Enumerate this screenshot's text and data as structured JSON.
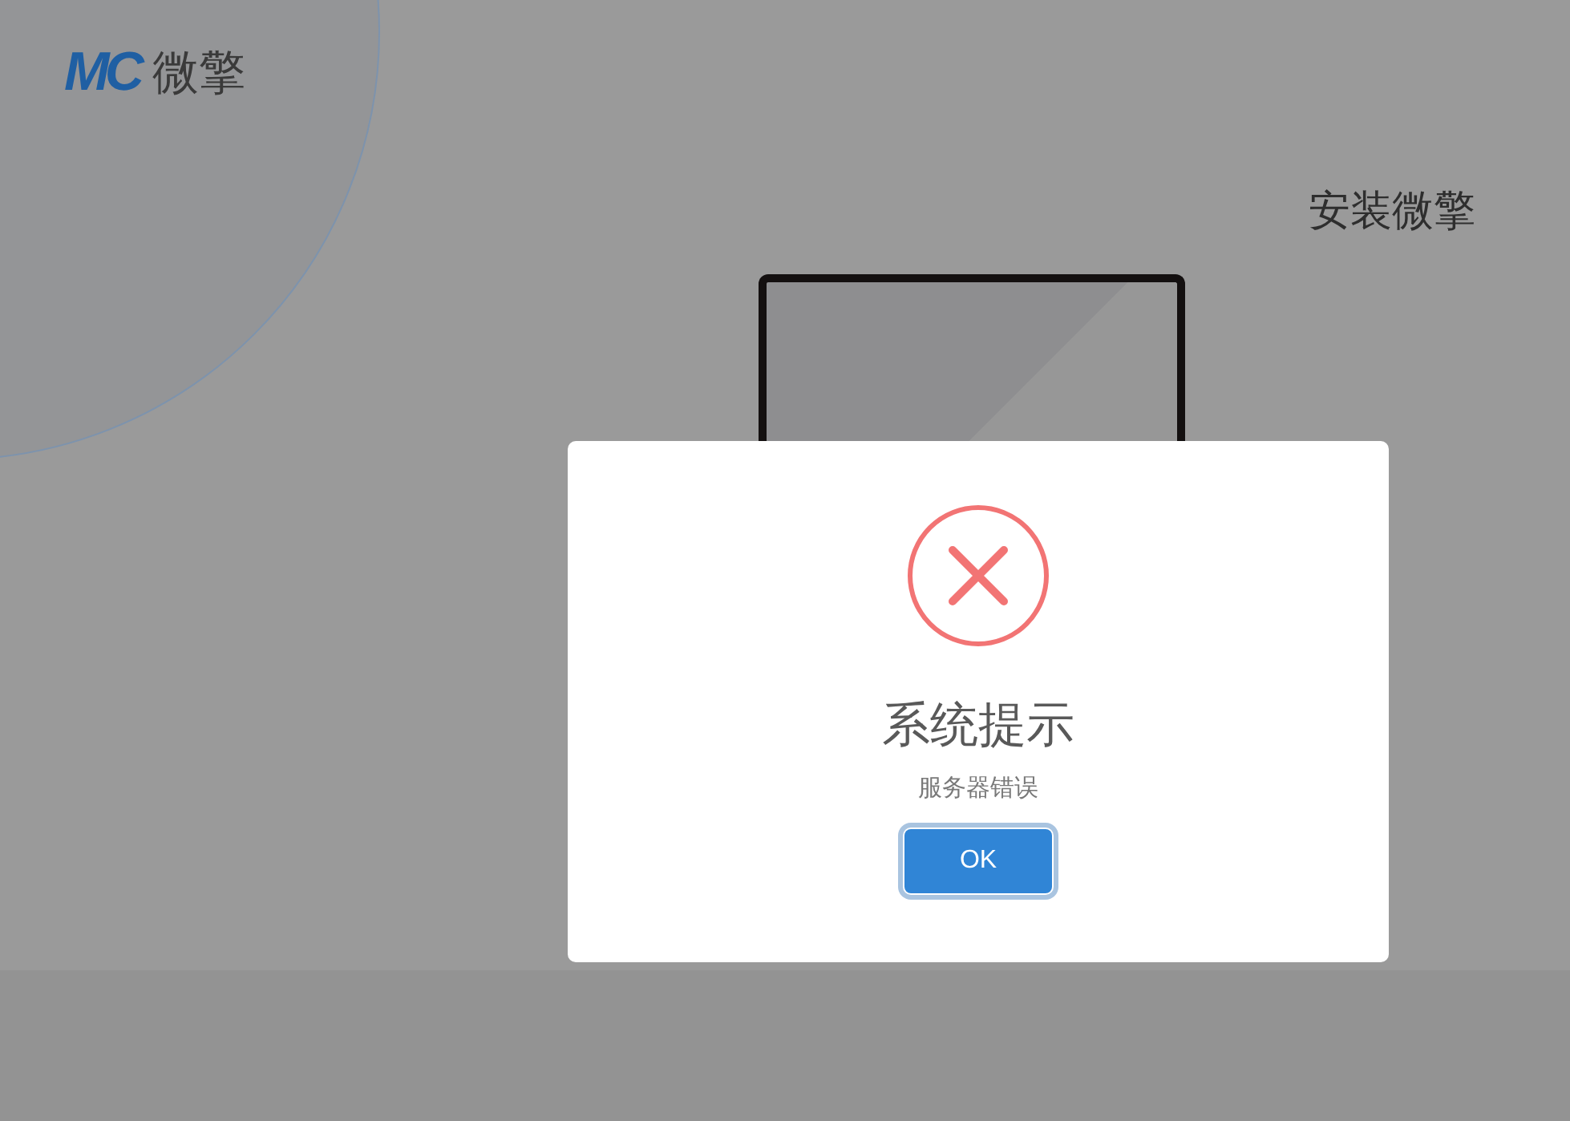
{
  "logo": {
    "mark": "MC",
    "name": "微擎"
  },
  "page_title": "安装微擎",
  "dialog": {
    "kind": "error",
    "title": "系统提示",
    "message": "服务器错误",
    "buttons": [
      {
        "label": "OK",
        "focused": true
      }
    ]
  }
}
